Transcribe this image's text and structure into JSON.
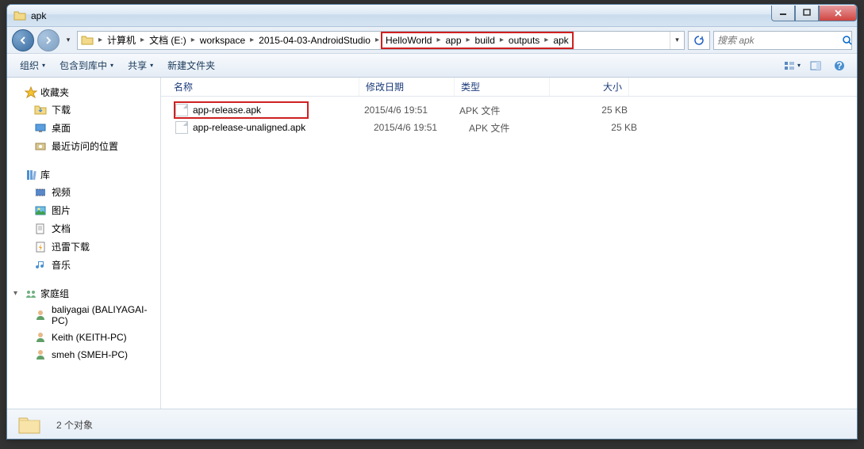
{
  "title": "apk",
  "breadcrumbs": {
    "pre": [
      {
        "label": "计算机"
      },
      {
        "label": "文档 (E:)"
      },
      {
        "label": "workspace"
      },
      {
        "label": "2015-04-03-AndroidStudio"
      }
    ],
    "highlighted": [
      {
        "label": "HelloWorld"
      },
      {
        "label": "app"
      },
      {
        "label": "build"
      },
      {
        "label": "outputs"
      },
      {
        "label": "apk"
      }
    ]
  },
  "search": {
    "placeholder": "搜索 apk"
  },
  "toolbar": {
    "organize": "组织",
    "include": "包含到库中",
    "share": "共享",
    "new_folder": "新建文件夹"
  },
  "sidebar": {
    "favorites": {
      "label": "收藏夹",
      "items": [
        "下载",
        "桌面",
        "最近访问的位置"
      ]
    },
    "libraries": {
      "label": "库",
      "items": [
        "视频",
        "图片",
        "文档",
        "迅雷下载",
        "音乐"
      ]
    },
    "homegroup": {
      "label": "家庭组",
      "items": [
        "baliyagai (BALIYAGAI-PC)",
        "Keith (KEITH-PC)",
        "smeh (SMEH-PC)"
      ]
    }
  },
  "columns": {
    "name": "名称",
    "date": "修改日期",
    "type": "类型",
    "size": "大小"
  },
  "files": [
    {
      "name": "app-release.apk",
      "date": "2015/4/6 19:51",
      "type": "APK 文件",
      "size": "25 KB",
      "highlighted": true
    },
    {
      "name": "app-release-unaligned.apk",
      "date": "2015/4/6 19:51",
      "type": "APK 文件",
      "size": "25 KB",
      "highlighted": false
    }
  ],
  "status": {
    "count_label": "2 个对象"
  }
}
